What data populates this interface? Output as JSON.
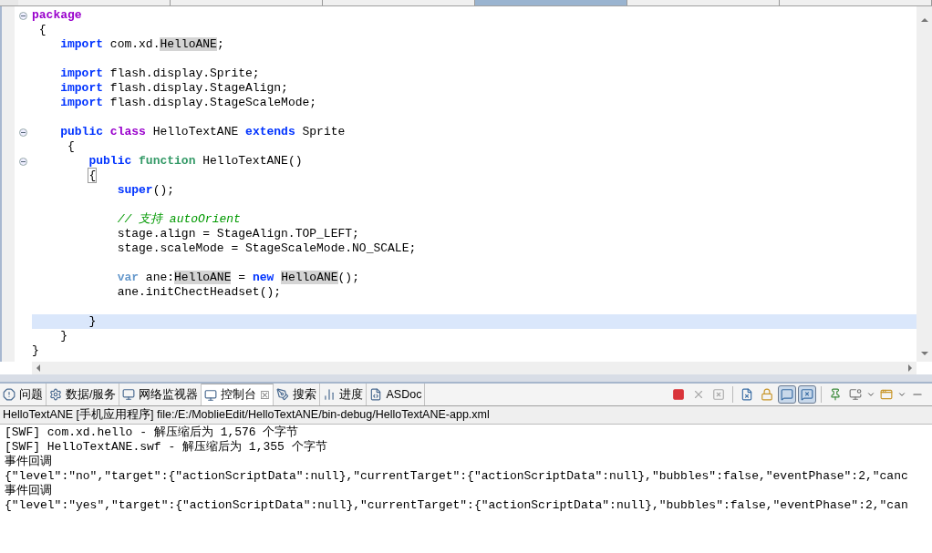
{
  "editor_tabs": [
    {
      "selected": false
    },
    {
      "selected": false
    },
    {
      "selected": false
    },
    {
      "selected": true
    },
    {
      "selected": false
    },
    {
      "selected": false
    }
  ],
  "code_lines": [
    {
      "fold": true,
      "current": false,
      "tokens": [
        {
          "kind": "purple",
          "text": "package"
        }
      ]
    },
    {
      "fold": false,
      "current": false,
      "tokens": [
        {
          "kind": "plain",
          "text": " {"
        }
      ]
    },
    {
      "fold": false,
      "current": false,
      "tokens": [
        {
          "kind": "keyword",
          "text": "    import"
        },
        {
          "kind": "plain",
          "text": " com.xd."
        },
        {
          "kind": "mark",
          "text": "HelloANE"
        },
        {
          "kind": "plain",
          "text": ";"
        }
      ]
    },
    {
      "fold": false,
      "current": false
    },
    {
      "fold": false,
      "current": false,
      "tokens": [
        {
          "kind": "keyword",
          "text": "    import"
        },
        {
          "kind": "plain",
          "text": " flash.display.Sprite;"
        }
      ]
    },
    {
      "fold": false,
      "current": false,
      "tokens": [
        {
          "kind": "keyword",
          "text": "    import"
        },
        {
          "kind": "plain",
          "text": " flash.display.StageAlign;"
        }
      ]
    },
    {
      "fold": false,
      "current": false,
      "tokens": [
        {
          "kind": "keyword",
          "text": "    import"
        },
        {
          "kind": "plain",
          "text": " flash.display.StageScaleMode;"
        }
      ]
    },
    {
      "fold": false,
      "current": false
    },
    {
      "fold": true,
      "current": false,
      "tokens": [
        {
          "kind": "keyword",
          "text": "    public "
        },
        {
          "kind": "purple",
          "text": "class"
        },
        {
          "kind": "plain",
          "text": " HelloTextANE "
        },
        {
          "kind": "keyword",
          "text": "extends"
        },
        {
          "kind": "plain",
          "text": " Sprite"
        }
      ]
    },
    {
      "fold": false,
      "current": false,
      "tokens": [
        {
          "kind": "plain",
          "text": "     {"
        }
      ]
    },
    {
      "fold": true,
      "current": false,
      "tokens": [
        {
          "kind": "keyword",
          "text": "        public "
        },
        {
          "kind": "function",
          "text": "function"
        },
        {
          "kind": "plain",
          "text": " HelloTextANE()"
        }
      ]
    },
    {
      "fold": false,
      "current": false,
      "tokens": [
        {
          "kind": "bracket",
          "text": "        {"
        }
      ]
    },
    {
      "fold": false,
      "current": false,
      "tokens": [
        {
          "kind": "keyword",
          "text": "            super"
        },
        {
          "kind": "plain",
          "text": "();"
        }
      ]
    },
    {
      "fold": false,
      "current": false
    },
    {
      "fold": false,
      "current": false,
      "tokens": [
        {
          "kind": "comment",
          "text": "            // 支持 autoOrient"
        }
      ]
    },
    {
      "fold": false,
      "current": false,
      "tokens": [
        {
          "kind": "plain",
          "text": "            stage.align = StageAlign.TOP_LEFT;"
        }
      ]
    },
    {
      "fold": false,
      "current": false,
      "tokens": [
        {
          "kind": "plain",
          "text": "            stage.scaleMode = StageScaleMode.NO_SCALE;"
        }
      ]
    },
    {
      "fold": false,
      "current": false
    },
    {
      "fold": false,
      "current": false,
      "tokens": [
        {
          "kind": "var",
          "text": "            var"
        },
        {
          "kind": "plain",
          "text": " ane:"
        },
        {
          "kind": "mark",
          "text": "HelloANE"
        },
        {
          "kind": "plain",
          "text": " = "
        },
        {
          "kind": "keyword",
          "text": "new "
        },
        {
          "kind": "mark",
          "text": "HelloANE"
        },
        {
          "kind": "plain",
          "text": "();"
        }
      ]
    },
    {
      "fold": false,
      "current": false,
      "tokens": [
        {
          "kind": "plain",
          "text": "            ane.initChectHeadset();"
        }
      ]
    },
    {
      "fold": false,
      "current": false
    },
    {
      "fold": false,
      "current": true,
      "tokens": [
        {
          "kind": "plain",
          "text": "        }"
        }
      ]
    },
    {
      "fold": false,
      "current": false,
      "tokens": [
        {
          "kind": "plain",
          "text": "    }"
        }
      ]
    },
    {
      "fold": false,
      "current": false,
      "tokens": [
        {
          "kind": "plain",
          "text": "}"
        }
      ]
    }
  ],
  "panel_tabs": [
    {
      "label": "问题",
      "selected": false
    },
    {
      "label": "数据/服务",
      "selected": false
    },
    {
      "label": "网络监视器",
      "selected": false
    },
    {
      "label": "控制台",
      "selected": true,
      "close": "☒"
    },
    {
      "label": "搜索",
      "selected": false
    },
    {
      "label": "进度",
      "selected": false
    },
    {
      "label": "ASDoc",
      "selected": false
    }
  ],
  "toolbar": [
    {
      "kind": "terminate",
      "disabled": false,
      "pressed": false
    },
    {
      "kind": "remove",
      "disabled": true,
      "pressed": false
    },
    {
      "kind": "removeall",
      "disabled": true,
      "pressed": false
    },
    {
      "kind": "sep"
    },
    {
      "kind": "clear",
      "disabled": false,
      "pressed": false
    },
    {
      "kind": "lock",
      "disabled": false,
      "pressed": false
    },
    {
      "kind": "stdout",
      "disabled": false,
      "pressed": true
    },
    {
      "kind": "stderr",
      "disabled": false,
      "pressed": true
    },
    {
      "kind": "sep"
    },
    {
      "kind": "pin",
      "disabled": false,
      "pressed": false
    },
    {
      "kind": "display",
      "disabled": false,
      "pressed": false
    },
    {
      "kind": "dropdown"
    },
    {
      "kind": "open",
      "disabled": false,
      "pressed": false
    },
    {
      "kind": "dropdown"
    },
    {
      "kind": "minimize",
      "disabled": false,
      "pressed": false
    }
  ],
  "console_path": "HelloTextANE [手机应用程序] file:/E:/MoblieEdit/HelloTextANE/bin-debug/HelloTextANE-app.xml",
  "console_lines": [
    "[SWF] com.xd.hello - 解压缩后为 1,576 个字节",
    "[SWF] HelloTextANE.swf - 解压缩后为 1,355 个字节",
    "事件回调",
    "{\"level\":\"no\",\"target\":{\"actionScriptData\":null},\"currentTarget\":{\"actionScriptData\":null},\"bubbles\":false,\"eventPhase\":2,\"canc",
    "事件回调",
    "{\"level\":\"yes\",\"target\":{\"actionScriptData\":null},\"currentTarget\":{\"actionScriptData\":null},\"bubbles\":false,\"eventPhase\":2,\"can"
  ]
}
